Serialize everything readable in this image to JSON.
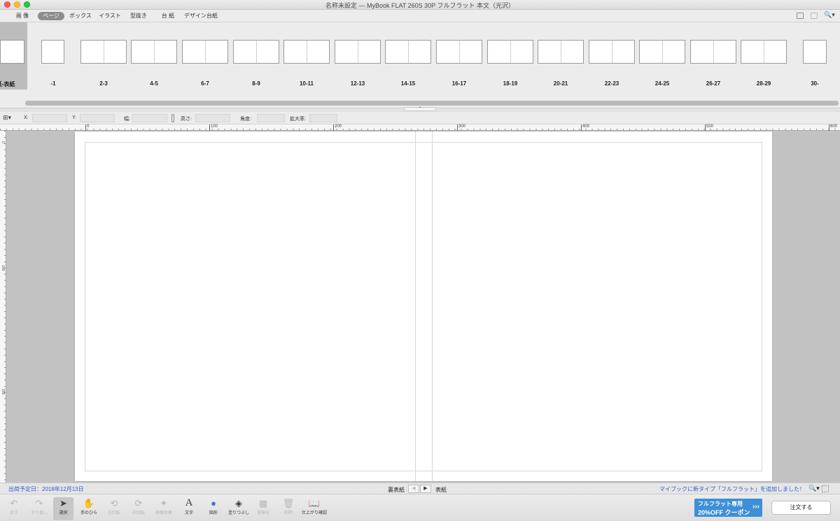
{
  "window": {
    "title": "名称未設定 — MyBook FLAT 260S 30P フルフラット 本文（光沢）"
  },
  "tabs": [
    {
      "label": "画 像",
      "active": false
    },
    {
      "label": "ページ",
      "active": true
    },
    {
      "label": "ボックス",
      "active": false
    },
    {
      "label": "イラスト",
      "active": false
    },
    {
      "label": "型抜き",
      "active": false
    },
    {
      "label": "台 紙",
      "active": false
    },
    {
      "label": "デザイン台紙",
      "active": false
    }
  ],
  "thumbnails": [
    {
      "label": "紙-表紙"
    },
    {
      "label": "-1"
    },
    {
      "label": "2-3"
    },
    {
      "label": "4-5"
    },
    {
      "label": "6-7"
    },
    {
      "label": "8-9"
    },
    {
      "label": "10-11"
    },
    {
      "label": "12-13"
    },
    {
      "label": "14-15"
    },
    {
      "label": "16-17"
    },
    {
      "label": "18-19"
    },
    {
      "label": "20-21"
    },
    {
      "label": "22-23"
    },
    {
      "label": "24-25"
    },
    {
      "label": "26-27"
    },
    {
      "label": "28-29"
    },
    {
      "label": "30-"
    }
  ],
  "splitter": {
    "label": "⌃"
  },
  "properties": {
    "x_label": "X:",
    "y_label": "Y:",
    "width_label": "幅:",
    "height_label": "高さ:",
    "angle_label": "角度:",
    "scale_label": "拡大率:"
  },
  "ruler": {
    "h_labels": [
      "0",
      "100",
      "200",
      "300",
      "400",
      "500",
      "600"
    ],
    "v_labels": [
      "0",
      "100",
      "200"
    ]
  },
  "status": {
    "ship_date": "出荷予定日：2018年12月13日",
    "prev_page": "裏表紙",
    "next_page": "表紙",
    "prev_btn": "◀",
    "next_btn": "▶",
    "news": "マイブックに新タイプ「フルフラット」を追加しました！",
    "zoom": "🔍▾"
  },
  "tools": [
    {
      "label": "戻す",
      "icon": "↶",
      "disabled": true
    },
    {
      "label": "やり直し",
      "icon": "↷",
      "disabled": true
    },
    {
      "label": "選択",
      "icon": "➤",
      "disabled": false,
      "selected": true
    },
    {
      "label": "手のひら",
      "icon": "✋",
      "disabled": false
    },
    {
      "label": "左回転",
      "icon": "⟲",
      "disabled": true
    },
    {
      "label": "右回転",
      "icon": "⟳",
      "disabled": true
    },
    {
      "label": "画像効果",
      "icon": "✦",
      "disabled": true
    },
    {
      "label": "文字",
      "icon": "A",
      "disabled": false
    },
    {
      "label": "図形",
      "icon": "●",
      "disabled": false
    },
    {
      "label": "塗りつぶし",
      "icon": "◈",
      "disabled": false
    },
    {
      "label": "背景化",
      "icon": "▦",
      "disabled": true
    },
    {
      "label": "削除",
      "icon": "🗑",
      "disabled": true
    },
    {
      "label": "仕上がり確認",
      "icon": "📖",
      "disabled": false
    }
  ],
  "coupon": {
    "line1": "フルフラット専用",
    "line2": "20%OFF クーポン",
    "arrows": "›››"
  },
  "order": {
    "label": "注文する"
  }
}
